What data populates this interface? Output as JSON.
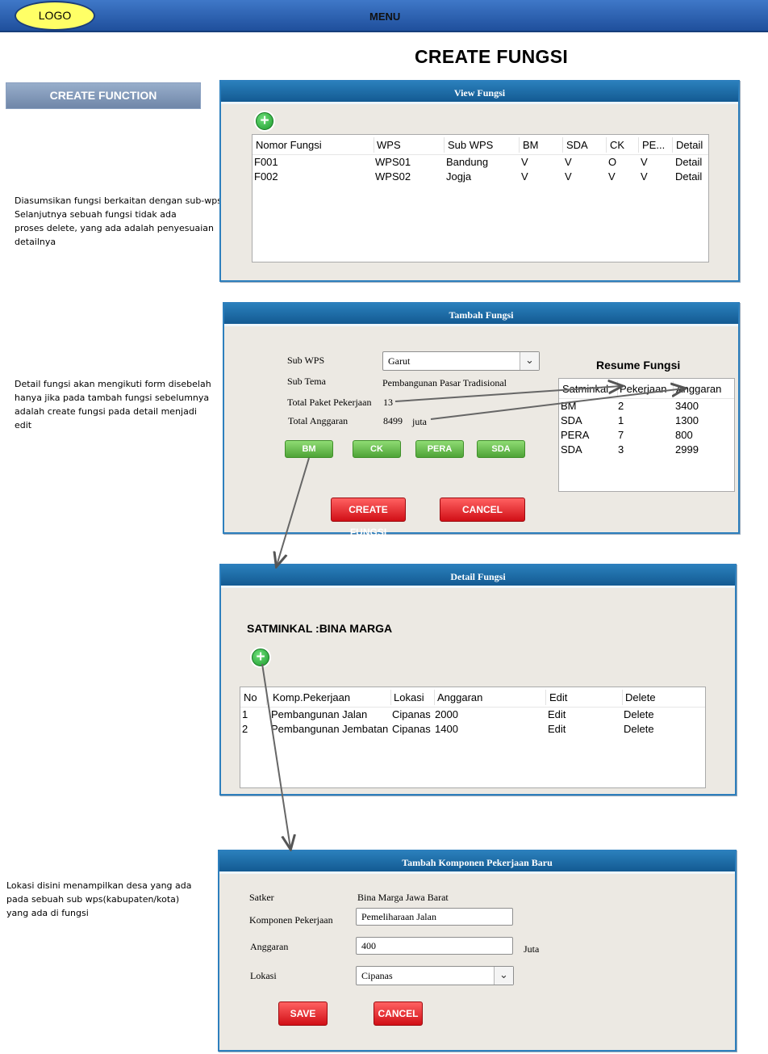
{
  "header": {
    "logo": "LOGO",
    "menu": "MENU"
  },
  "page_title": "CREATE FUNGSI",
  "sidebar": {
    "button": "CREATE FUNCTION"
  },
  "notes": {
    "view": "Diasumsikan fungsi berkaitan dengan sub-wps.\nSelanjutnya sebuah fungsi tidak ada\nproses delete, yang ada adalah penyesuaian\ndetailnya",
    "tambah": "Detail fungsi akan mengikuti form disebelah\nhanya jika pada tambah fungsi sebelumnya\nadalah create fungsi pada detail menjadi\nedit",
    "lokasi": "Lokasi disini menampilkan desa yang ada\npada sebuah sub wps(kabupaten/kota)\nyang ada di fungsi"
  },
  "view_fungsi": {
    "title": "View Fungsi",
    "columns": [
      "Nomor Fungsi",
      "WPS",
      "Sub WPS",
      "BM",
      "SDA",
      "CK",
      "PE...",
      "Detail"
    ],
    "rows": [
      [
        "F001",
        "WPS01",
        "Bandung",
        "V",
        "V",
        "O",
        "V",
        "Detail"
      ],
      [
        "F002",
        "WPS02",
        "Jogja",
        "V",
        "V",
        "V",
        "V",
        "Detail"
      ]
    ]
  },
  "tambah_fungsi": {
    "title": "Tambah Fungsi",
    "sub_wps_label": "Sub WPS",
    "sub_wps_value": "Garut",
    "sub_tema_label": "Sub Tema",
    "sub_tema_value": "Pembangunan Pasar Tradisional",
    "total_paket_label": "Total Paket Pekerjaan",
    "total_paket_value": "13",
    "total_anggaran_label": "Total Anggaran",
    "total_anggaran_value": "8499",
    "total_anggaran_unit": "juta",
    "buttons": [
      "BM",
      "CK",
      "PERA",
      "SDA"
    ],
    "create_button": "CREATE FUNGSI",
    "cancel_button": "CANCEL",
    "resume": {
      "title": "Resume Fungsi",
      "columns": [
        "Satminkal",
        "Pekerjaan",
        "Anggaran"
      ],
      "rows": [
        [
          "BM",
          "2",
          "3400"
        ],
        [
          "SDA",
          "1",
          "1300"
        ],
        [
          "PERA",
          "7",
          "800"
        ],
        [
          "SDA",
          "3",
          "2999"
        ]
      ]
    }
  },
  "detail_fungsi": {
    "title": "Detail Fungsi",
    "satminkal": "SATMINKAL :BINA MARGA",
    "columns": [
      "No",
      "Komp.Pekerjaan",
      "Lokasi",
      "Anggaran",
      "Edit",
      "Delete"
    ],
    "rows": [
      [
        "1",
        "Pembangunan Jalan",
        "Cipanas",
        "2000",
        "Edit",
        "Delete"
      ],
      [
        "2",
        "Pembangunan Jembatan",
        "Cipanas",
        "1400",
        "Edit",
        "Delete"
      ]
    ]
  },
  "tambah_komponen": {
    "title": "Tambah Komponen Pekerjaan Baru",
    "satker_label": "Satker",
    "satker_value": "Bina Marga Jawa Barat",
    "komponen_label": "Komponen Pekerjaan",
    "komponen_value": "Pemeliharaan Jalan",
    "anggaran_label": "Anggaran",
    "anggaran_value": "400",
    "anggaran_unit": "Juta",
    "lokasi_label": "Lokasi",
    "lokasi_value": "Cipanas",
    "save_button": "SAVE",
    "cancel_button": "CANCEL"
  }
}
